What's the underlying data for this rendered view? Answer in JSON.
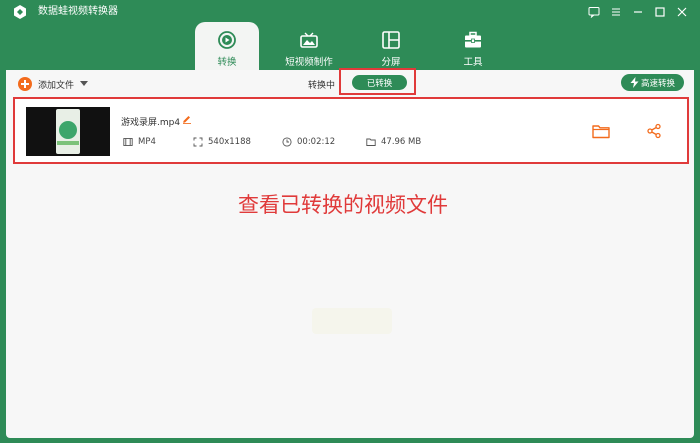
{
  "app": {
    "title": "数据蛙视频转换器"
  },
  "window_controls": [
    "chat-icon",
    "menu-icon",
    "minimize-icon",
    "maximize-icon",
    "close-icon"
  ],
  "tabs": [
    {
      "label": "转换",
      "icon": "convert-icon",
      "active": true
    },
    {
      "label": "短视频制作",
      "icon": "short-video-icon",
      "active": false
    },
    {
      "label": "分屏",
      "icon": "split-screen-icon",
      "active": false
    },
    {
      "label": "工具",
      "icon": "toolbox-icon",
      "active": false
    }
  ],
  "toolbar": {
    "add_file": "添加文件",
    "converting": "转换中",
    "converted": "已转换",
    "high_speed": "高速转换"
  },
  "file": {
    "name": "游戏录屏.mp4",
    "format": "MP4",
    "resolution": "540x1188",
    "duration": "00:02:12",
    "size": "47.96 MB"
  },
  "annotation": "查看已转换的视频文件",
  "colors": {
    "primary": "#2e8b57",
    "accent": "#f36b1c",
    "highlight": "#e03a3a"
  }
}
